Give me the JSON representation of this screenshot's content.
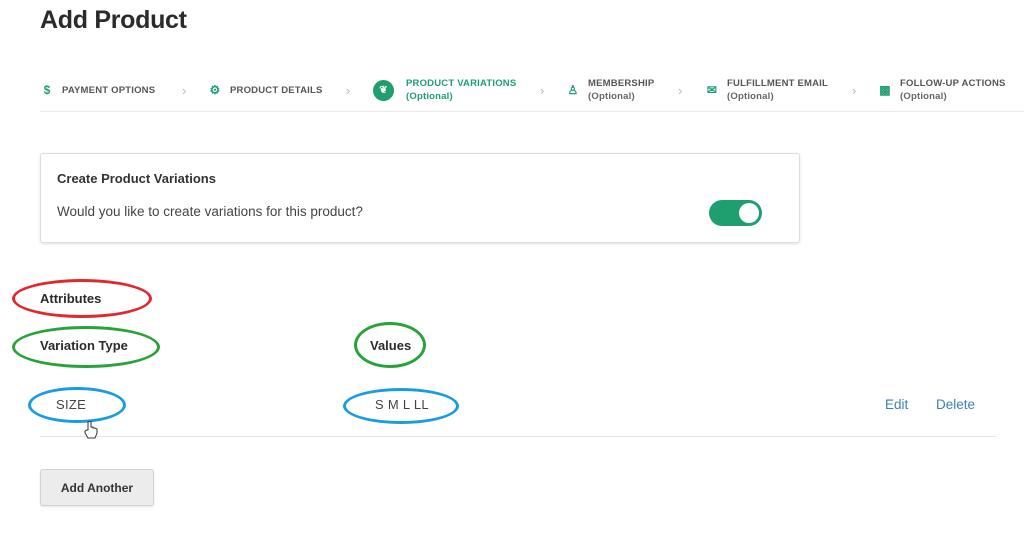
{
  "page_title": "Add Product",
  "steps": [
    {
      "label": "PAYMENT OPTIONS",
      "sub": "",
      "icon": "dollar-icon"
    },
    {
      "label": "PRODUCT DETAILS",
      "sub": "",
      "icon": "gears-icon"
    },
    {
      "label": "PRODUCT VARIATIONS",
      "sub": "(Optional)",
      "icon": "variations-icon",
      "active": true
    },
    {
      "label": "MEMBERSHIP",
      "sub": "(Optional)",
      "icon": "users-icon"
    },
    {
      "label": "FULFILLMENT EMAIL",
      "sub": "(Optional)",
      "icon": "envelope-icon"
    },
    {
      "label": "FOLLOW-UP ACTIONS",
      "sub": "(Optional)",
      "icon": "puzzle-icon"
    }
  ],
  "card": {
    "title": "Create Product Variations",
    "question": "Would you like to create variations for this product?",
    "toggle_on": true
  },
  "attributes": {
    "heading": "Attributes",
    "col_type": "Variation Type",
    "col_values": "Values",
    "rows": [
      {
        "type": "SIZE",
        "values": "S M L LL",
        "edit": "Edit",
        "delete": "Delete"
      }
    ]
  },
  "add_button": "Add Another",
  "colors": {
    "accent": "#1f9e6f",
    "link": "#3a7fbf",
    "annot_red": "#e0282e",
    "annot_green": "#2aa23a",
    "annot_blue": "#1a9de0"
  }
}
